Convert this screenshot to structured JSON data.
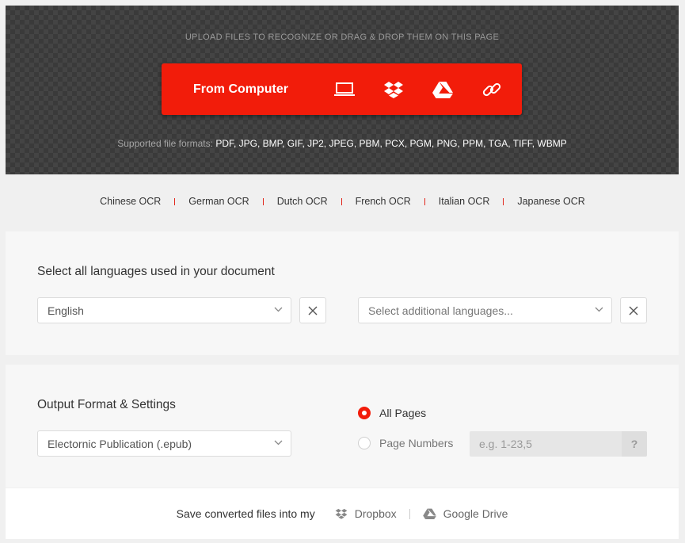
{
  "upload": {
    "title": "UPLOAD FILES TO RECOGNIZE OR DRAG & DROP THEM ON THIS PAGE",
    "from_computer": "From Computer",
    "formats_label": "Supported file formats:",
    "formats_list": "PDF, JPG, BMP, GIF, JP2, JPEG, PBM, PCX, PGM, PNG, PPM, TGA, TIFF, WBMP",
    "accent": "#f21c0a",
    "icons": [
      "laptop-icon",
      "dropbox-icon",
      "google-drive-icon",
      "link-icon"
    ]
  },
  "ocr_links": [
    "Chinese OCR",
    "German OCR",
    "Dutch OCR",
    "French OCR",
    "Italian OCR",
    "Japanese OCR"
  ],
  "languages": {
    "title": "Select all languages used in your document",
    "primary_value": "English",
    "additional_placeholder": "Select additional languages..."
  },
  "output": {
    "title": "Output Format & Settings",
    "format_value": "Electornic Publication (.epub)",
    "all_pages_label": "All Pages",
    "all_pages_selected": true,
    "page_numbers_label": "Page Numbers",
    "page_numbers_placeholder": "e.g. 1-23,5",
    "help_label": "?"
  },
  "save": {
    "label": "Save converted files into my",
    "dropbox": "Dropbox",
    "google_drive": "Google Drive"
  }
}
